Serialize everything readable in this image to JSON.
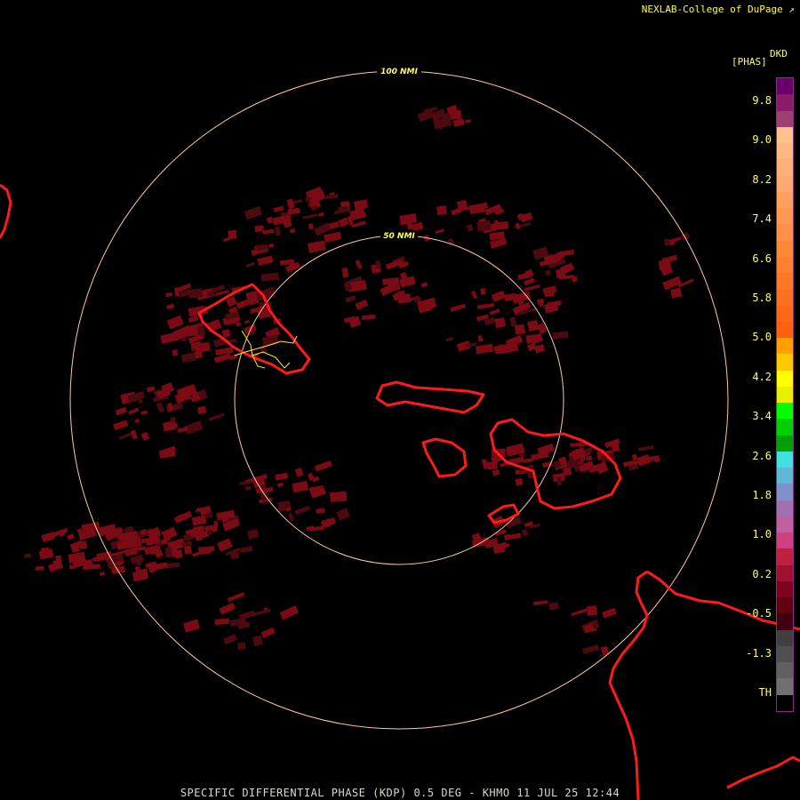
{
  "credit": {
    "text": "NEXLAB-College of DuPage",
    "icon": "link-arrow-icon"
  },
  "scale": {
    "product": "DKD",
    "unit": "[PHAS]",
    "ticks": [
      "9.8",
      "9.0",
      "8.2",
      "7.4",
      "6.6",
      "5.8",
      "5.0",
      "4.2",
      "3.4",
      "2.6",
      "1.8",
      "1.0",
      "0.2",
      "-0.5",
      "-1.3",
      "TH"
    ],
    "colors": [
      "#6a006a",
      "#8a1a6a",
      "#a04070",
      "#ffc08a",
      "#ffb880",
      "#ffb078",
      "#ffa870",
      "#ffa060",
      "#ff9850",
      "#ff9048",
      "#ff8838",
      "#ff8030",
      "#ff7828",
      "#ff7020",
      "#ff6818",
      "#ff6010",
      "#ffa000",
      "#ffc800",
      "#ffff00",
      "#e8f000",
      "#00ff00",
      "#00d000",
      "#00a000",
      "#40e0e0",
      "#60b8d8",
      "#8090c8",
      "#a070b0",
      "#c060a0",
      "#d04080",
      "#c02040",
      "#a01030",
      "#800020",
      "#600010",
      "#400010",
      "#404040",
      "#505050",
      "#606060",
      "#707070",
      "#000000"
    ]
  },
  "rings": [
    {
      "label": "100 NMI"
    },
    {
      "label": "50 NMI"
    }
  ],
  "footer": "SPECIFIC DIFFERENTIAL PHASE (KDP) 0.5 DEG - KHMO 11 JUL 25 12:44",
  "colors": {
    "ring": "#ffc8a0",
    "echo": "#7a0a14",
    "coast": "#ff1a1a",
    "label": "#ffff55"
  }
}
